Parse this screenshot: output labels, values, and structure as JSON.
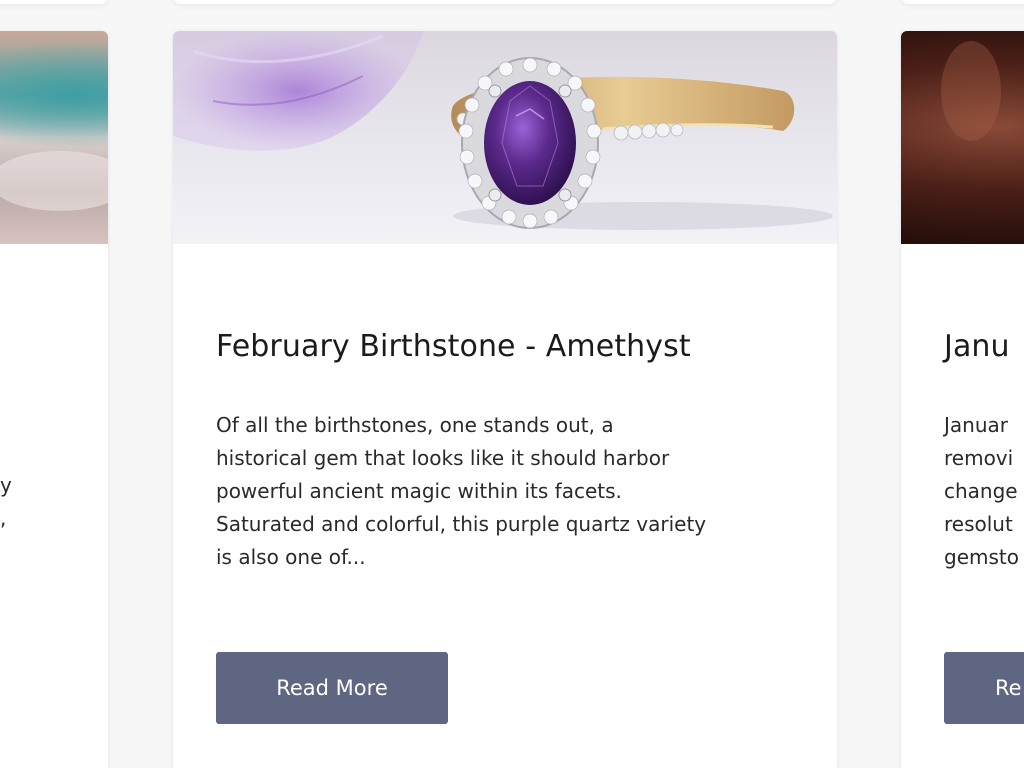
{
  "cards": {
    "left": {
      "excerpt_fragment": "y\n,"
    },
    "center": {
      "title": "February Birthstone - Amethyst",
      "excerpt": "Of all the birthstones, one stands out, a\nhistorical gem that looks like it should harbor\npowerful ancient magic within its facets.\nSaturated and colorful, this purple quartz variety\nis also one of...",
      "button_label": "Read More",
      "image_subject": "amethyst halo ring"
    },
    "right": {
      "title_fragment": "Janu",
      "excerpt_fragment": "Januar\nremovi\nchange\nresolut\ngemsto",
      "button_label_fragment": "Re"
    }
  },
  "colors": {
    "button": "#5f6682",
    "card_background": "#ffffff",
    "page_background": "#f7f7f8",
    "amethyst": "#5b2a8c"
  }
}
